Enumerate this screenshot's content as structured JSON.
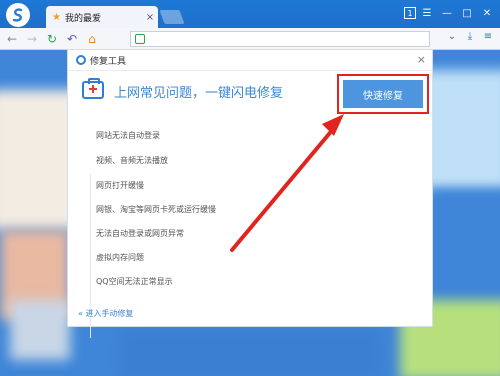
{
  "browser": {
    "tab_title": "我的最爱",
    "tab_close": "×",
    "window_controls": [
      "1",
      "☰",
      "—",
      "□",
      "✕"
    ]
  },
  "dialog": {
    "title": "修复工具",
    "close": "×",
    "headline": "上网常见问题，一键闪电修复",
    "fix_button": "快速修复",
    "issues": [
      "网站无法自动登录",
      "视频、音频无法播放",
      "网页打开缓慢",
      "网银、淘宝等网页卡死或运行缓慢",
      "无法自动登录或网页异常",
      "虚拟内存问题",
      "QQ空间无法正常显示"
    ],
    "manual_link": "«  进入手动修复"
  },
  "colors": {
    "accent": "#3a88d6",
    "button": "#4d95df",
    "highlight": "#e02420"
  }
}
